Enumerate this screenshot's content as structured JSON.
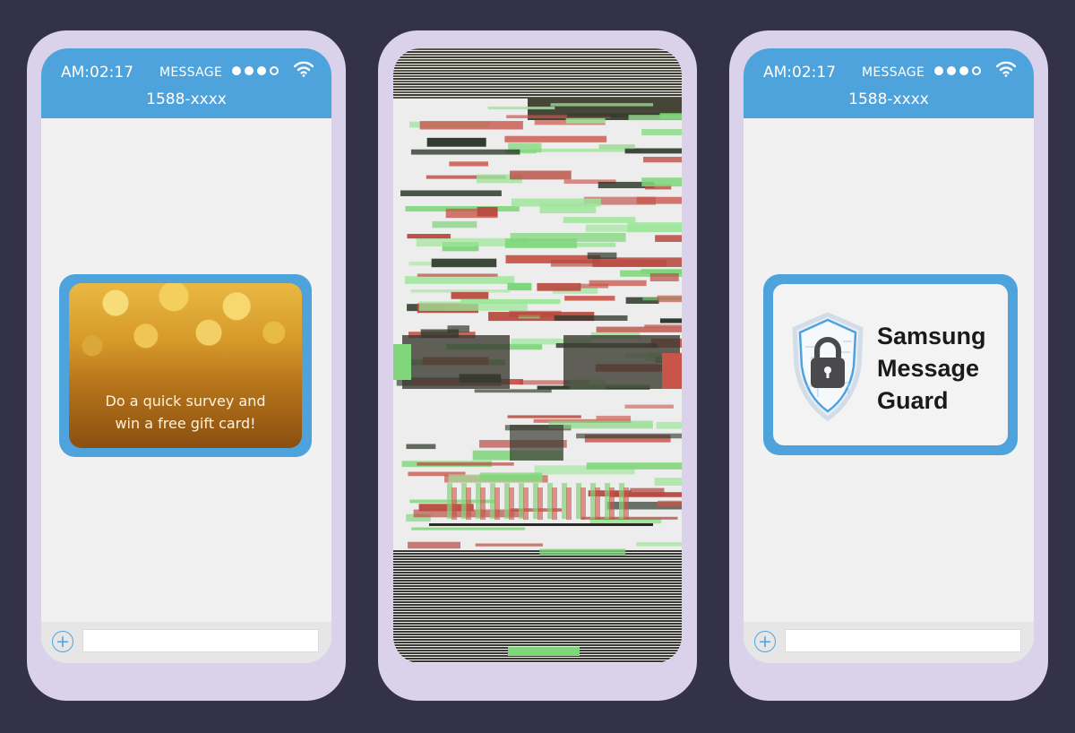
{
  "phones": [
    {
      "status": {
        "time": "AM:02:17",
        "app": "MESSAGE"
      },
      "contact": "1588-xxxx",
      "message_card": {
        "text_line1": "Do a quick survey and",
        "text_line2": "win a free gift card!"
      },
      "compose": {
        "placeholder": ""
      }
    },
    {
      "glitch": {
        "description": "glitching skull"
      }
    },
    {
      "status": {
        "time": "AM:02:17",
        "app": "MESSAGE"
      },
      "contact": "1588-xxxx",
      "message_card": {
        "line1": "Samsung",
        "line2": "Message",
        "line3": "Guard"
      },
      "compose": {
        "placeholder": ""
      }
    }
  ],
  "colors": {
    "accent": "#4ea3dc",
    "phone_frame": "#d9d2ea",
    "background": "#33324a"
  }
}
